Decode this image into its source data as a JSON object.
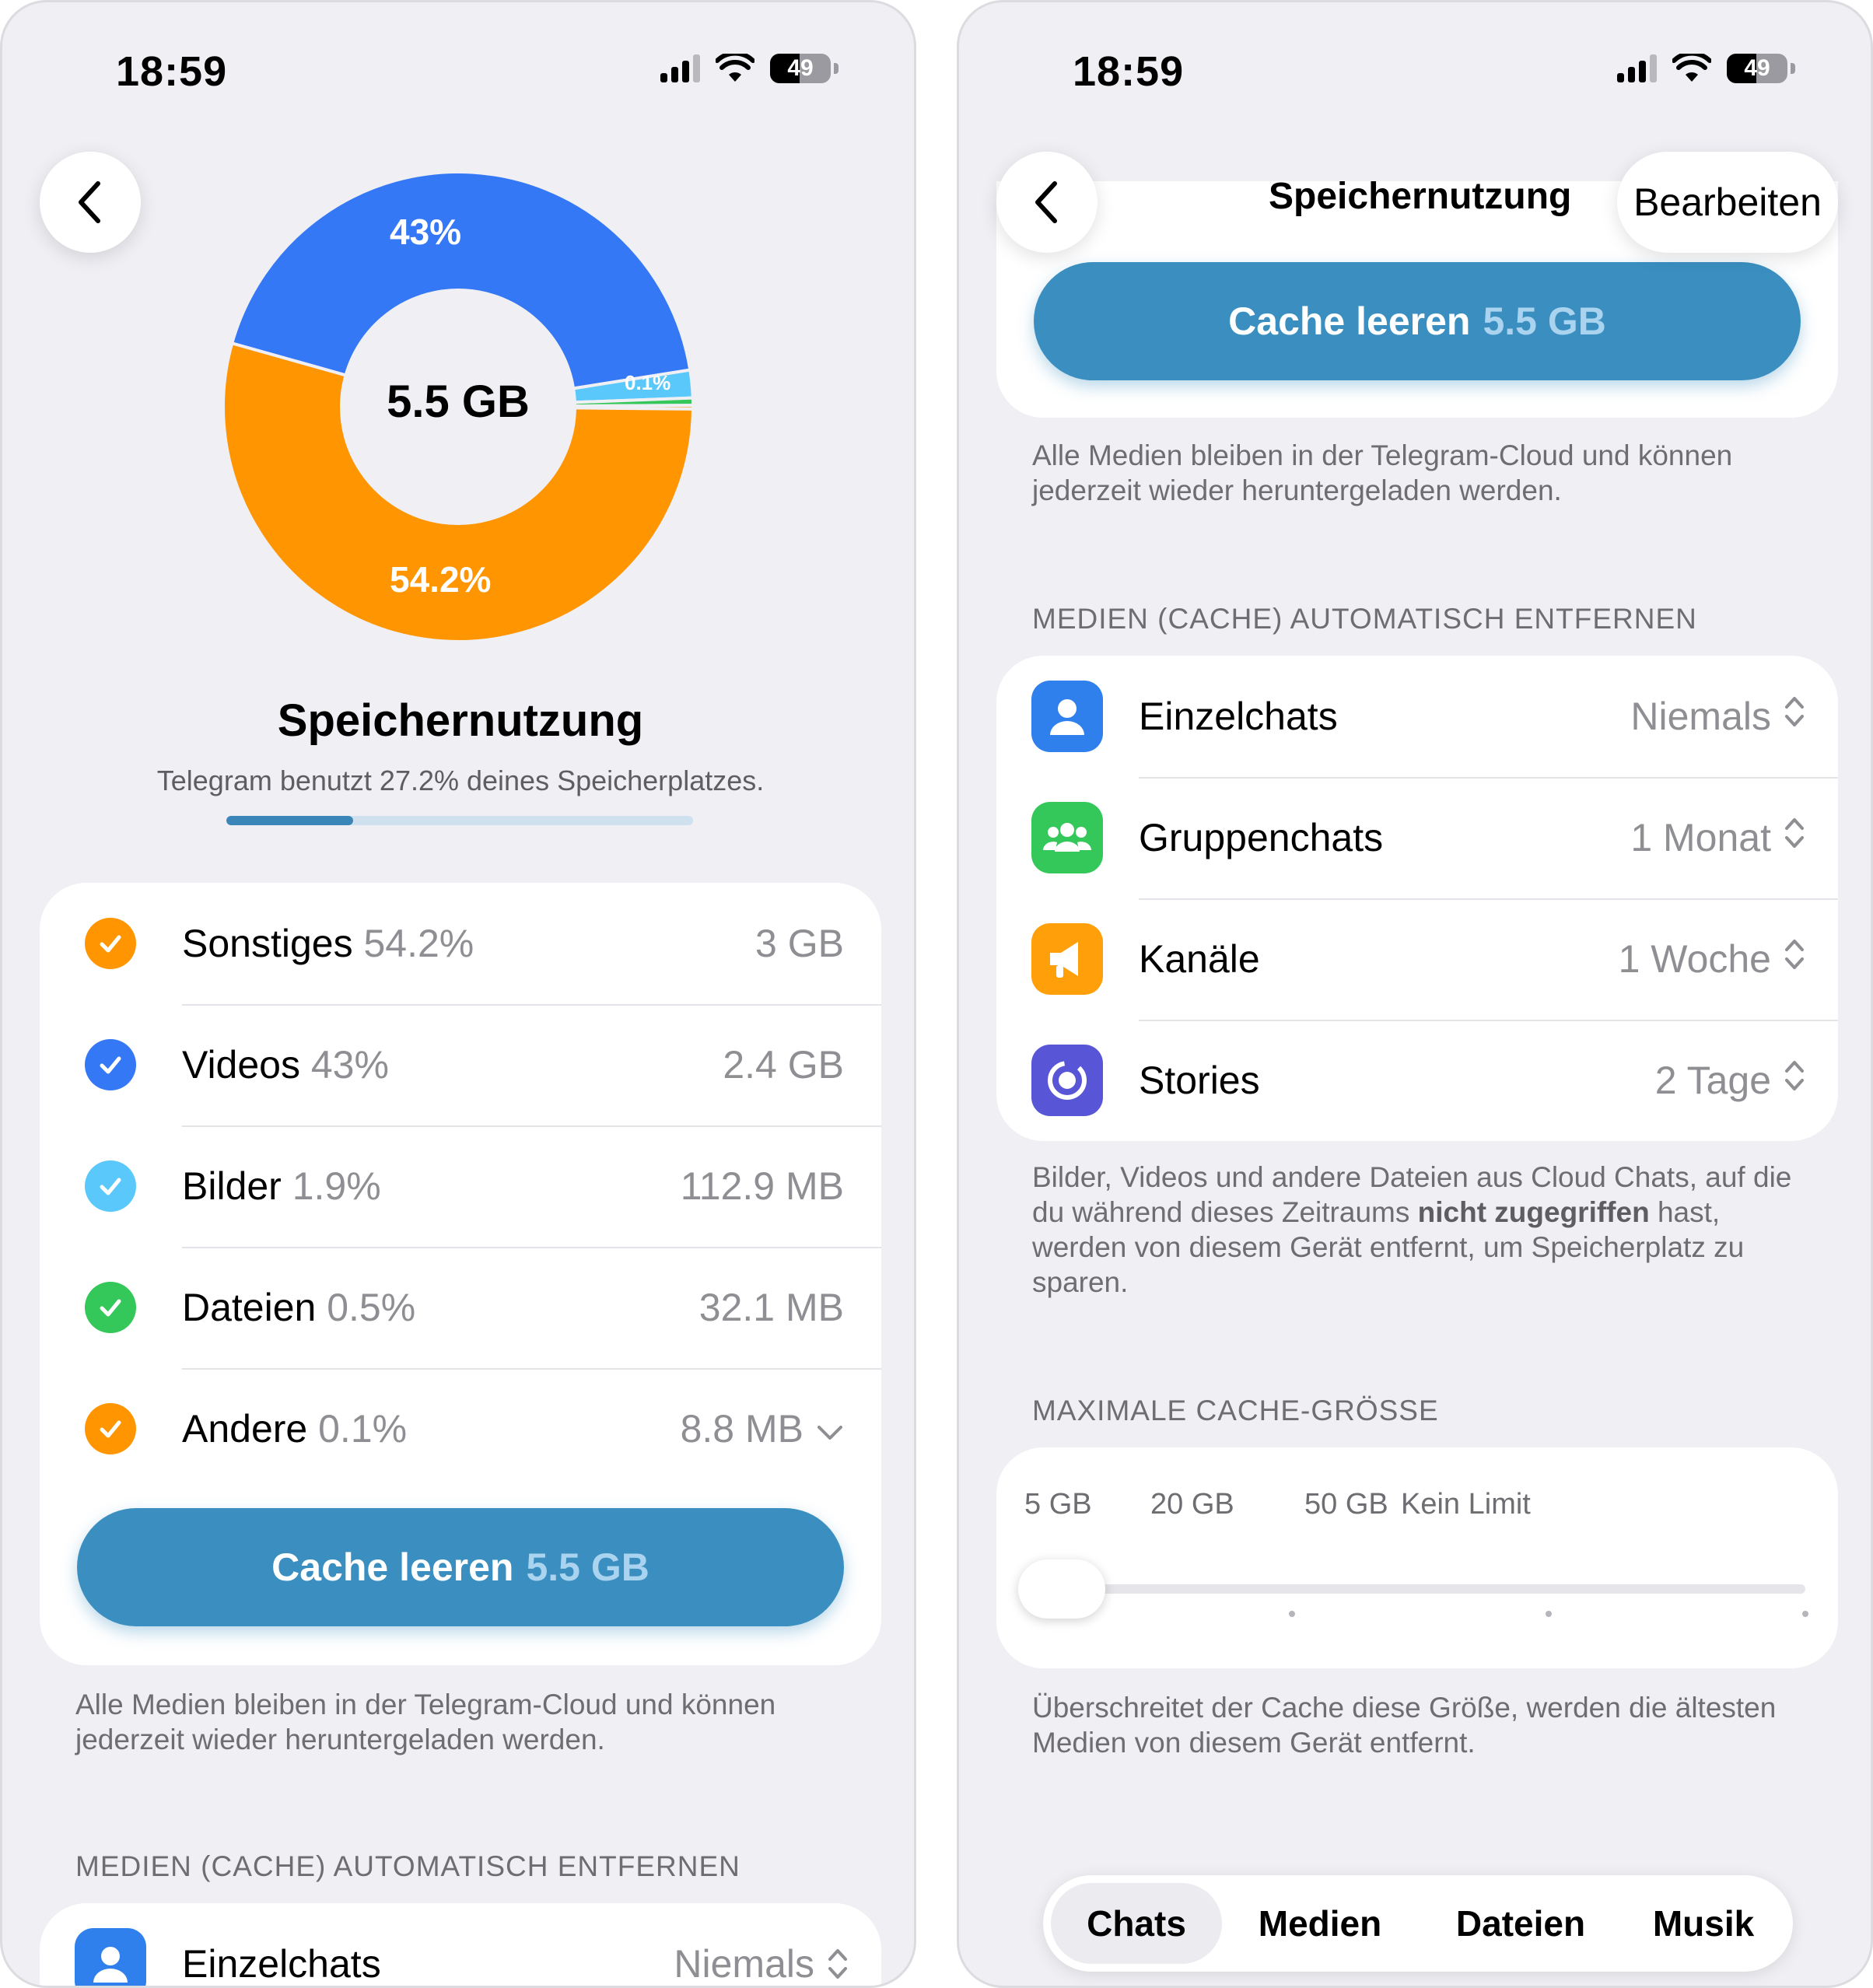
{
  "left": {
    "status": {
      "time": "18:59",
      "battery": "49"
    },
    "chart_data": {
      "type": "pie",
      "center_label": "5.5 GB",
      "slices": [
        {
          "name": "Sonstiges",
          "value": 54.2,
          "label": "54.2%",
          "color": "#ff9500"
        },
        {
          "name": "Videos",
          "value": 43,
          "label": "43%",
          "color": "#3478f6"
        },
        {
          "name": "Bilder",
          "value": 1.9,
          "label": "",
          "color": "#5ac8fa"
        },
        {
          "name": "Dateien",
          "value": 0.5,
          "label": "",
          "color": "#34c759"
        },
        {
          "name": "Andere",
          "value": 0.1,
          "label": "0.1%",
          "color": "#ff9500"
        }
      ]
    },
    "title": "Speichernutzung",
    "subtitle": "Telegram benutzt 27.2% deines Speicherplatzes.",
    "usage_fraction": 0.272,
    "categories": [
      {
        "name": "Sonstiges",
        "pct": "54.2%",
        "size": "3 GB",
        "color": "#ff9500"
      },
      {
        "name": "Videos",
        "pct": "43%",
        "size": "2.4 GB",
        "color": "#3478f6"
      },
      {
        "name": "Bilder",
        "pct": "1.9%",
        "size": "112.9 MB",
        "color": "#5ac8fa"
      },
      {
        "name": "Dateien",
        "pct": "0.5%",
        "size": "32.1 MB",
        "color": "#34c759"
      },
      {
        "name": "Andere",
        "pct": "0.1%",
        "size": "8.8 MB",
        "color": "#ff9500"
      }
    ],
    "cache_button": {
      "label": "Cache leeren",
      "size": "5.5 GB"
    },
    "note": "Alle Medien bleiben in der Telegram-Cloud und können jederzeit wieder heruntergeladen werden.",
    "section_auto_remove": "MEDIEN (CACHE) AUTOMATISCH ENTFERNEN",
    "partial_row": {
      "name": "Einzelchats",
      "value": "Niemals"
    }
  },
  "right": {
    "status": {
      "time": "18:59",
      "battery": "49"
    },
    "nav_title": "Speichernutzung",
    "edit_label": "Bearbeiten",
    "cache_button": {
      "label": "Cache leeren",
      "size": "5.5 GB"
    },
    "note": "Alle Medien bleiben in der Telegram-Cloud und können jederzeit wieder heruntergeladen werden.",
    "section_auto_remove": "MEDIEN (CACHE) AUTOMATISCH ENTFERNEN",
    "settings": [
      {
        "name": "Einzelchats",
        "value": "Niemals",
        "icon": "person-icon",
        "color": "#2f80ed"
      },
      {
        "name": "Gruppenchats",
        "value": "1 Monat",
        "icon": "group-icon",
        "color": "#34c759"
      },
      {
        "name": "Kanäle",
        "value": "1 Woche",
        "icon": "megaphone-icon",
        "color": "#ff9f0a"
      },
      {
        "name": "Stories",
        "value": "2 Tage",
        "icon": "stories-icon",
        "color": "#5856d6"
      }
    ],
    "auto_remove_note": {
      "part1": "Bilder, Videos und andere Dateien aus Cloud Chats, auf die du während dieses Zeitraums ",
      "bold": "nicht zugegriffen",
      "part2": " hast, werden von diesem Gerät entfernt, um Speicherplatz zu sparen."
    },
    "section_max_cache": "MAXIMALE CACHE-GRÖSSE",
    "slider": {
      "options": [
        "5 GB",
        "20 GB",
        "50 GB",
        "Kein Limit"
      ],
      "selected_index": 0
    },
    "max_cache_note": "Überschreitet der Cache diese Größe, werden die ältesten Medien von diesem Gerät entfernt.",
    "tabs": [
      {
        "label": "Chats",
        "active": true
      },
      {
        "label": "Medien",
        "active": false
      },
      {
        "label": "Dateien",
        "active": false
      },
      {
        "label": "Musik",
        "active": false
      }
    ]
  }
}
